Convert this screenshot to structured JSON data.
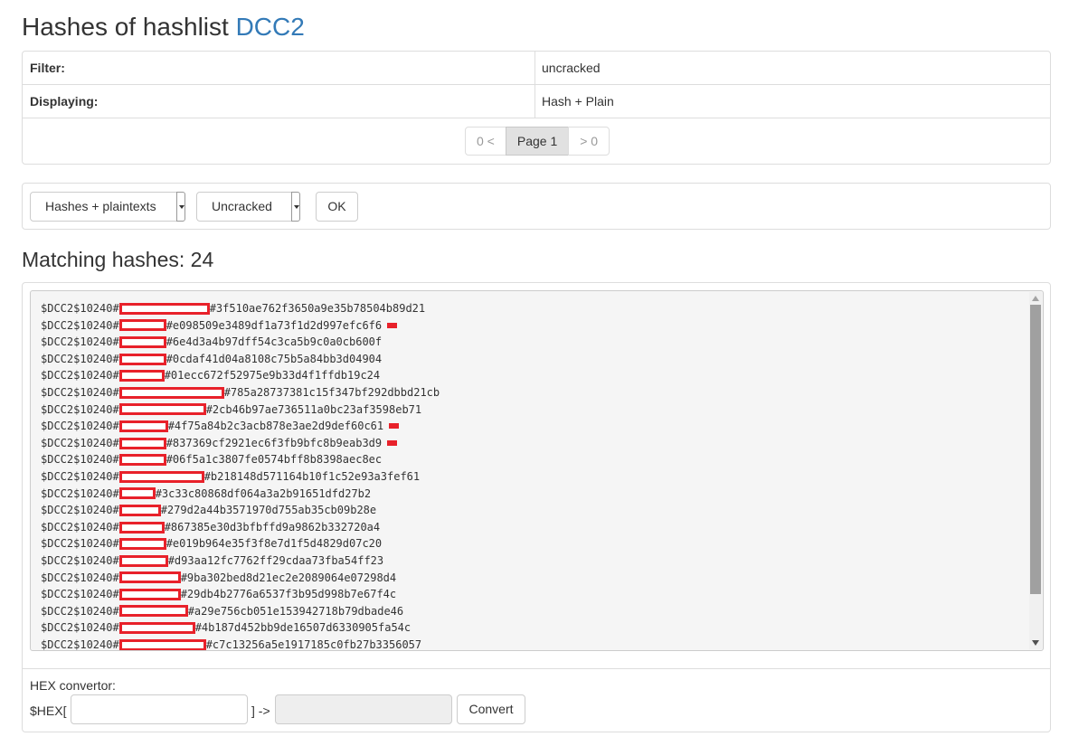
{
  "page": {
    "title_prefix": "Hashes of hashlist",
    "hashlist_name": "DCC2"
  },
  "info": {
    "rows": [
      {
        "key": "Filter:",
        "value": "uncracked"
      },
      {
        "key": "Displaying:",
        "value": "Hash + Plain"
      }
    ],
    "pagination": {
      "prev": "0 <",
      "current": "Page 1",
      "next": "> 0"
    }
  },
  "filters": {
    "display_select": "Hashes + plaintexts",
    "state_select": "Uncracked",
    "ok_label": "OK"
  },
  "results": {
    "title": "Matching hashes: 24",
    "lines": [
      {
        "prefix": "$DCC2$10240#",
        "hash": "#3f510ae762f3650a9e35b78504b89d21",
        "mark": false
      },
      {
        "prefix": "$DCC2$10240#",
        "hash": "#e098509e3489df1a73f1d2d997efc6f6",
        "mark": true
      },
      {
        "prefix": "$DCC2$10240#",
        "hash": "#6e4d3a4b97dff54c3ca5b9c0a0cb600f",
        "mark": false
      },
      {
        "prefix": "$DCC2$10240#",
        "hash": "#0cdaf41d04a8108c75b5a84bb3d04904",
        "mark": false
      },
      {
        "prefix": "$DCC2$10240#",
        "hash": "#01ecc672f52975e9b33d4f1ffdb19c24",
        "mark": false
      },
      {
        "prefix": "$DCC2$10240#",
        "hash": "#785a28737381c15f347bf292dbbd21cb",
        "mark": false
      },
      {
        "prefix": "$DCC2$10240#",
        "hash": "#2cb46b97ae736511a0bc23af3598eb71",
        "mark": false
      },
      {
        "prefix": "$DCC2$10240#",
        "hash": "#4f75a84b2c3acb878e3ae2d9def60c61",
        "mark": true
      },
      {
        "prefix": "$DCC2$10240#",
        "hash": "#837369cf2921ec6f3fb9bfc8b9eab3d9",
        "mark": true
      },
      {
        "prefix": "$DCC2$10240#",
        "hash": "#06f5a1c3807fe0574bff8b8398aec8ec",
        "mark": false
      },
      {
        "prefix": "$DCC2$10240#",
        "hash": "#b218148d571164b10f1c52e93a3fef61",
        "mark": false
      },
      {
        "prefix": "$DCC2$10240#",
        "hash": "#3c33c80868df064a3a2b91651dfd27b2",
        "mark": false
      },
      {
        "prefix": "$DCC2$10240#",
        "hash": "#279d2a44b3571970d755ab35cb09b28e",
        "mark": false
      },
      {
        "prefix": "$DCC2$10240#",
        "hash": "#867385e30d3bfbffd9a9862b332720a4",
        "mark": false
      },
      {
        "prefix": "$DCC2$10240#",
        "hash": "#e019b964e35f3f8e7d1f5d4829d07c20",
        "mark": false
      },
      {
        "prefix": "$DCC2$10240#",
        "hash": "#d93aa12fc7762ff29cdaa73fba54ff23",
        "mark": false
      },
      {
        "prefix": "$DCC2$10240#",
        "hash": "#9ba302bed8d21ec2e2089064e07298d4",
        "mark": false
      },
      {
        "prefix": "$DCC2$10240#",
        "hash": "#29db4b2776a6537f3b95d998b7e67f4c",
        "mark": false
      },
      {
        "prefix": "$DCC2$10240#",
        "hash": "#a29e756cb051e153942718b79dbade46",
        "mark": false
      },
      {
        "prefix": "$DCC2$10240#",
        "hash": "#4b187d452bb9de16507d6330905fa54c",
        "mark": false
      },
      {
        "prefix": "$DCC2$10240#",
        "hash": "#c7c13256a5e1917185c0fb27b3356057",
        "mark": false
      }
    ]
  },
  "hex": {
    "label": "HEX convertor:",
    "prefix": "$HEX[",
    "middle": "] ->",
    "input_value": "",
    "output_value": "",
    "convert_label": "Convert"
  },
  "colors": {
    "link": "#337ab7",
    "redaction": "#e8212a"
  },
  "icons": {
    "select_caret": "caret-down-icon",
    "scroll_up": "arrow-up-icon",
    "scroll_down": "arrow-down-icon"
  }
}
